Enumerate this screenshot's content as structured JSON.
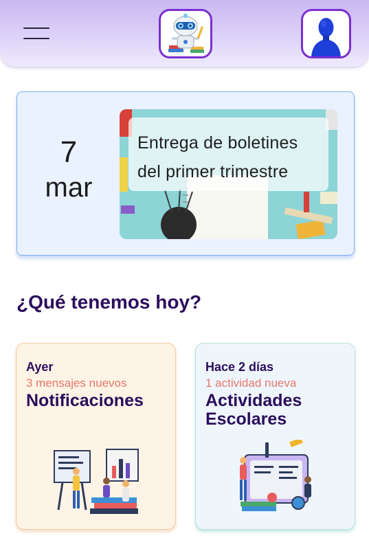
{
  "header": {
    "menu_icon": "hamburger-menu-icon",
    "logo_icon": "robot-mascot-logo",
    "avatar_icon": "user-avatar-icon",
    "accent_color": "#7a2fd0"
  },
  "event": {
    "day": "7",
    "month": "mar",
    "title_line1": "Entrega de boletines",
    "title_line2": "del primer trimestre"
  },
  "section": {
    "title": "¿Qué tenemos hoy?"
  },
  "cards": [
    {
      "when": "Ayer",
      "count": "3 mensajes nuevos",
      "title": "Notificaciones",
      "illustration": "teacher-presentation-illustration"
    },
    {
      "when": "Hace 2 días",
      "count": "1 actividad nueva",
      "title_line1": "Actividades",
      "title_line2": "Escolares",
      "illustration": "school-supplies-illustration"
    }
  ]
}
